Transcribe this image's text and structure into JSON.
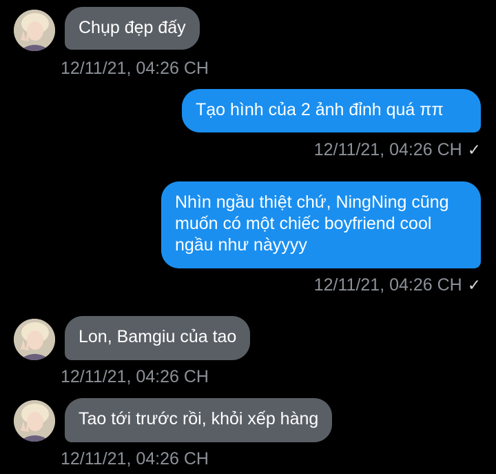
{
  "messages": [
    {
      "direction": "incoming",
      "text": "Chụp đẹp đấy",
      "time": "12/11/21, 04:26 CH"
    },
    {
      "direction": "outgoing",
      "text": "Tạo hình của 2 ảnh đỉnh quá ππ",
      "time": "12/11/21, 04:26 CH",
      "status": "✓"
    },
    {
      "direction": "outgoing",
      "text": "Nhìn ngầu thiệt chứ, NingNing cũng muốn có một chiếc boyfriend cool ngầu như nàyyyy",
      "time": "12/11/21, 04:26 CH",
      "status": "✓"
    },
    {
      "direction": "incoming",
      "text": "Lon, Bamgiu của tao",
      "time": "12/11/21, 04:26 CH"
    },
    {
      "direction": "incoming",
      "text": "Tao tới trước rồi, khỏi xếp hàng",
      "time": "12/11/21, 04:26 CH"
    }
  ],
  "colors": {
    "incoming_bubble": "#5a5f66",
    "outgoing_bubble": "#1a8ff0",
    "timestamp": "#8c9198",
    "background": "#000000"
  },
  "icons": {
    "avatar": "contact-avatar",
    "read_receipt": "check-icon"
  }
}
